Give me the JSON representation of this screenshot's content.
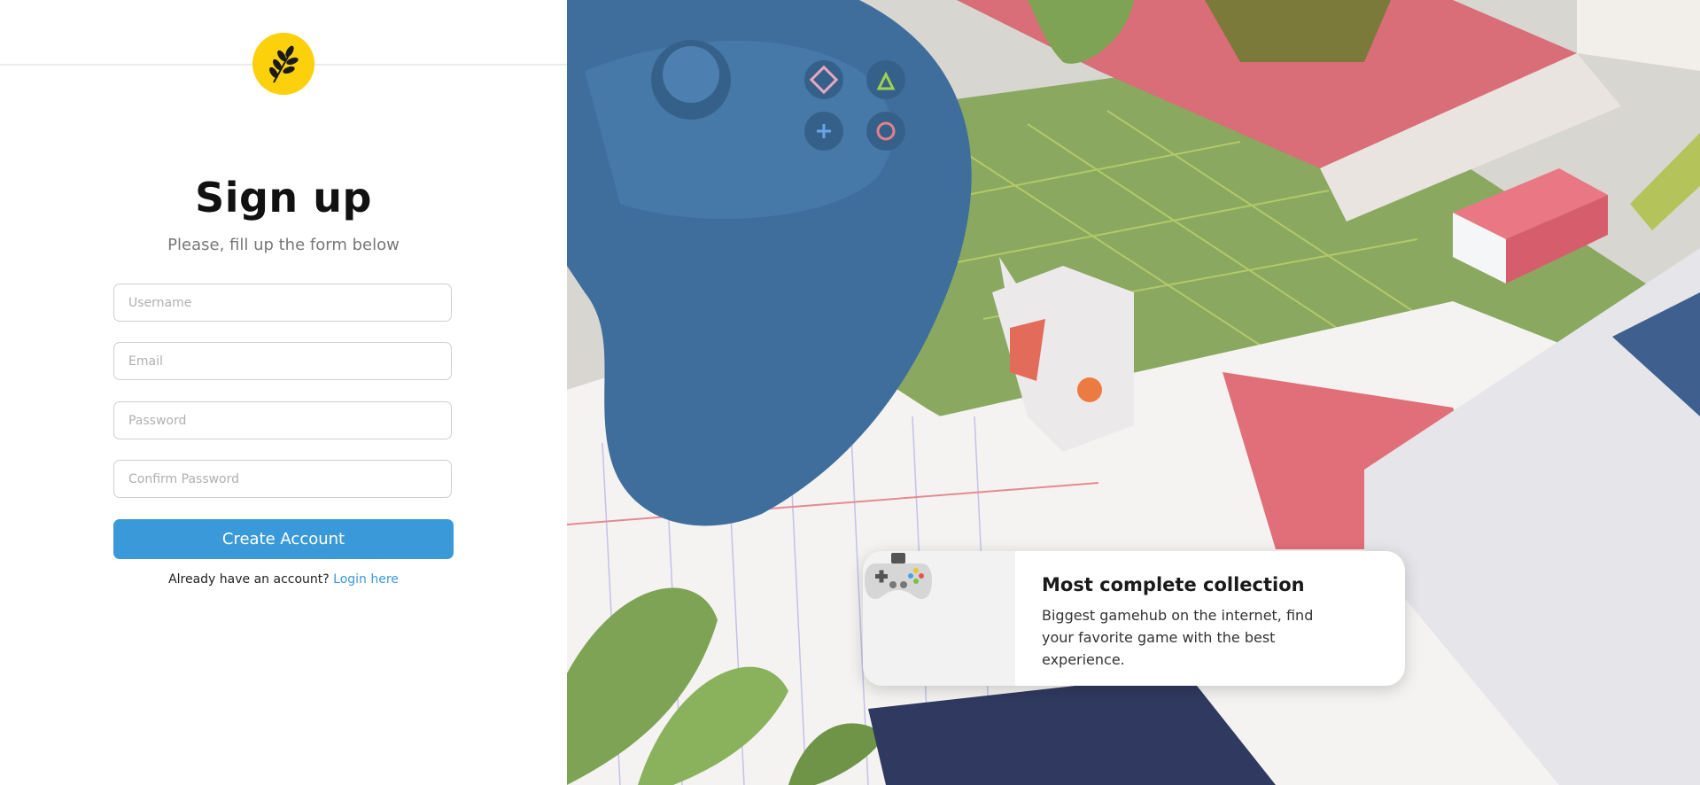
{
  "signup": {
    "title": "Sign up",
    "subtitle": "Please, fill up the form below",
    "fields": {
      "username_placeholder": "Username",
      "email_placeholder": "Email",
      "password_placeholder": "Password",
      "confirm_placeholder": "Confirm Password"
    },
    "submit_label": "Create Account",
    "login_prompt": "Already have an account?",
    "login_link": "Login here"
  },
  "logo": {
    "icon": "wheat-icon",
    "color": "#fcd00b"
  },
  "feature": {
    "icon": "gamepad-icon",
    "title": "Most complete collection",
    "description": "Biggest gamehub on the internet, find your favorite game with the best experience."
  },
  "colors": {
    "accent": "#3a9ad9",
    "logo_yellow": "#fcd00b",
    "controller_blue": "#3f6e9c",
    "mat_green": "#8aa860",
    "sticky_pink": "#d9707a"
  }
}
